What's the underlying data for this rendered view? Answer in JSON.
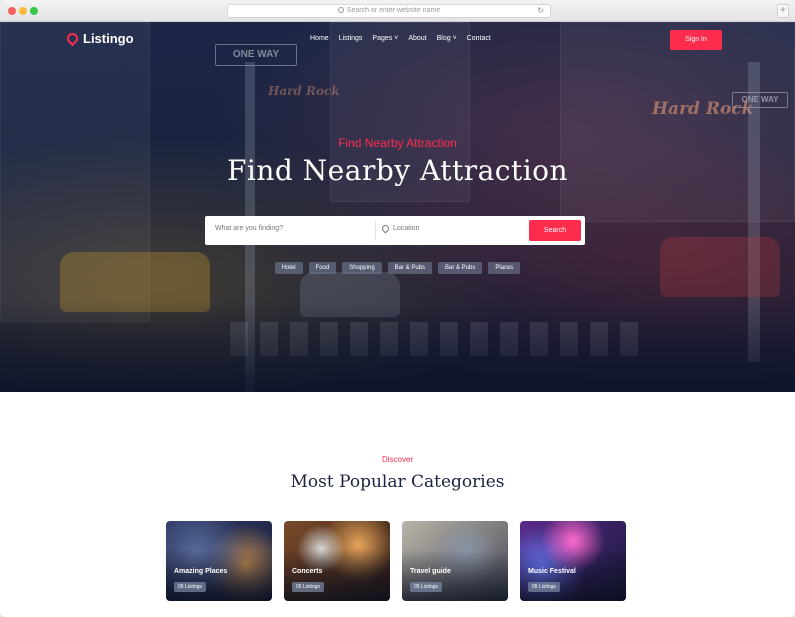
{
  "browser": {
    "address_placeholder": "Search or enter website name",
    "reload_icon": "reload-icon",
    "new_tab_label": "+"
  },
  "header": {
    "logo_text": "Listingo",
    "nav": [
      {
        "label": "Home"
      },
      {
        "label": "Listings"
      },
      {
        "label": "Pages ˅"
      },
      {
        "label": "About"
      },
      {
        "label": "Blog ˅"
      },
      {
        "label": "Contact"
      }
    ],
    "signin_label": "Sign In"
  },
  "hero": {
    "kicker": "Find Nearby Attraction",
    "headline": "Find Nearby Attraction",
    "search_placeholder": "What are you finding?",
    "location_placeholder": "Location",
    "search_button": "Search",
    "tags": [
      "Hotel",
      "Food",
      "Shopping",
      "Bar & Pubs",
      "Bar & Pubs",
      "Places"
    ],
    "signs": {
      "one_way_left": "ONE WAY",
      "one_way_right": "ONE WAY",
      "hard_rock": "Hard Rock"
    }
  },
  "categories": {
    "kicker": "Discover",
    "title": "Most Popular Categories",
    "items": [
      {
        "title": "Amazing Places",
        "count": "05 Listings"
      },
      {
        "title": "Concerts",
        "count": "05 Listings"
      },
      {
        "title": "Travel guide",
        "count": "05 Listings"
      },
      {
        "title": "Music Festival",
        "count": "05 Listings"
      }
    ]
  },
  "colors": {
    "accent": "#ff2c4d",
    "hero_overlay": "#1c2747",
    "heading": "#1b2340"
  }
}
